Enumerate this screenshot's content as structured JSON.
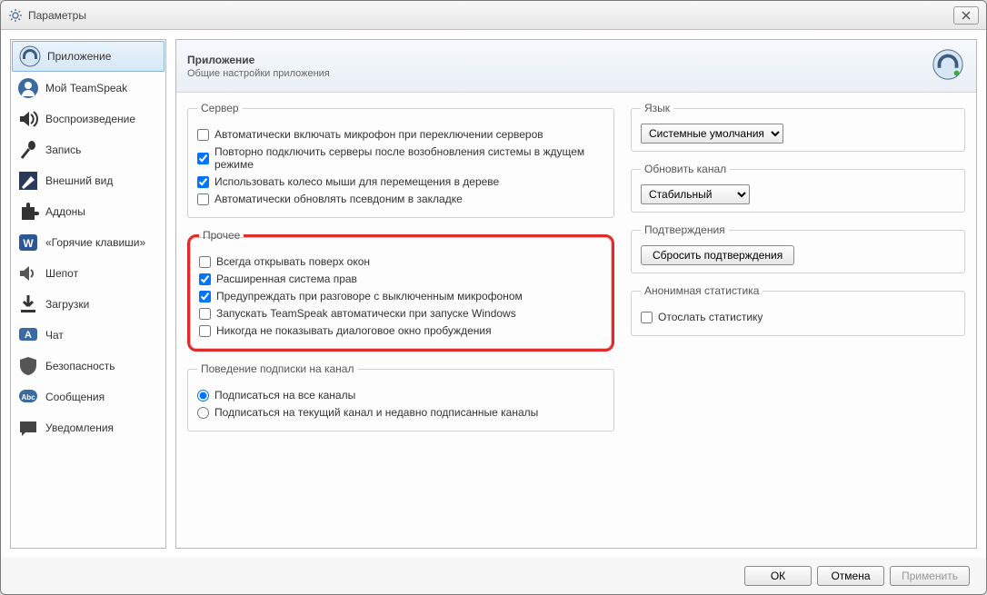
{
  "window": {
    "title": "Параметры"
  },
  "sidebar": {
    "items": [
      {
        "label": "Приложение"
      },
      {
        "label": "Мой TeamSpeak"
      },
      {
        "label": "Воспроизведение"
      },
      {
        "label": "Запись"
      },
      {
        "label": "Внешний вид"
      },
      {
        "label": "Аддоны"
      },
      {
        "label": "«Горячие клавиши»"
      },
      {
        "label": "Шепот"
      },
      {
        "label": "Загрузки"
      },
      {
        "label": "Чат"
      },
      {
        "label": "Безопасность"
      },
      {
        "label": "Сообщения"
      },
      {
        "label": "Уведомления"
      }
    ]
  },
  "header": {
    "title": "Приложение",
    "subtitle": "Общие настройки приложения"
  },
  "groups": {
    "server": {
      "legend": "Сервер",
      "mic_on_switch": "Автоматически включать микрофон при переключении серверов",
      "reconnect": "Повторно подключить серверы после возобновления системы в ждущем режиме",
      "mouse_wheel": "Использовать колесо мыши для перемещения в дереве",
      "auto_nick": "Автоматически обновлять псевдоним в закладке"
    },
    "other": {
      "legend": "Прочее",
      "always_top": "Всегда открывать поверх окон",
      "adv_perm": "Расширенная система прав",
      "warn_mic": "Предупреждать при разговоре с выключенным микрофоном",
      "autostart": "Запускать TeamSpeak автоматически при запуске Windows",
      "no_wakeup": "Никогда не показывать диалоговое окно пробуждения"
    },
    "channel_sub": {
      "legend": "Поведение подписки на канал",
      "sub_all": "Подписаться на все каналы",
      "sub_current": "Подписаться на текущий канал и недавно подписанные каналы"
    },
    "language": {
      "legend": "Язык",
      "value": "Системные умолчания"
    },
    "update_channel": {
      "legend": "Обновить канал",
      "value": "Стабильный"
    },
    "confirmations": {
      "legend": "Подтверждения",
      "reset_btn": "Сбросить подтверждения"
    },
    "anon_stats": {
      "legend": "Анонимная статистика",
      "send": "Отослать статистику"
    }
  },
  "footer": {
    "ok": "ОК",
    "cancel": "Отмена",
    "apply": "Применить"
  }
}
